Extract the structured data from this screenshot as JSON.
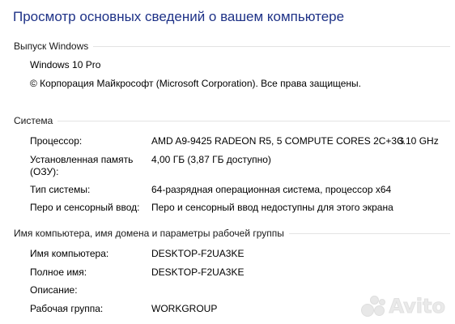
{
  "page_title": "Просмотр основных сведений о вашем компьютере",
  "windows_edition": {
    "header": "Выпуск Windows",
    "edition": "Windows 10 Pro",
    "copyright": "© Корпорация Майкрософт (Microsoft Corporation). Все права защищены."
  },
  "system": {
    "header": "Система",
    "processor_label": "Процессор:",
    "processor_value": "AMD A9-9425 RADEON R5, 5 COMPUTE CORES 2C+3G",
    "processor_speed": "3.10 GHz",
    "memory_label_line1": "Установленная память",
    "memory_label_line2": "(ОЗУ):",
    "memory_value": "4,00 ГБ (3,87 ГБ доступно)",
    "system_type_label": "Тип системы:",
    "system_type_value": "64-разрядная операционная система, процессор x64",
    "pen_touch_label": "Перо и сенсорный ввод:",
    "pen_touch_value": "Перо и сенсорный ввод недоступны для этого экрана"
  },
  "computer_name": {
    "header": "Имя компьютера, имя домена и параметры рабочей группы",
    "computer_name_label": "Имя компьютера:",
    "computer_name_value": "DESKTOP-F2UA3KE",
    "full_name_label": "Полное имя:",
    "full_name_value": "DESKTOP-F2UA3KE",
    "description_label": "Описание:",
    "description_value": "",
    "workgroup_label": "Рабочая группа:",
    "workgroup_value": "WORKGROUP"
  },
  "watermark": {
    "text": "Avito",
    "icon": "avito-logo-icon"
  },
  "colors": {
    "title": "#1e3287",
    "rule": "#e3e3e3",
    "background": "#ffffff"
  }
}
